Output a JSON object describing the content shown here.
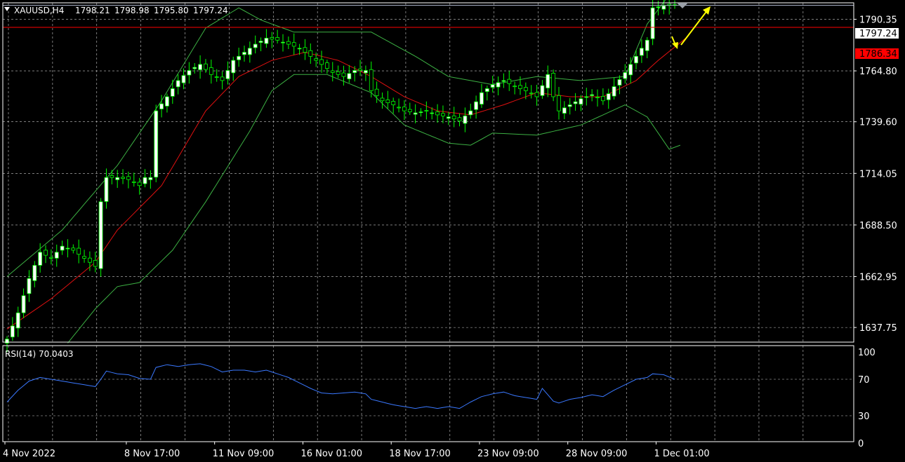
{
  "header": {
    "symbol": "XAUUSD,H4",
    "open": "1798.21",
    "high": "1798.98",
    "low": "1795.80",
    "close": "1797.24"
  },
  "rsi_panel": {
    "label": "RSI(14) 70.0403"
  },
  "colors": {
    "background": "#000000",
    "grid": "#c8c8c8",
    "bull_candle": "#ffffff",
    "bear_candle": "#000000",
    "candle_outline": "#00ff00",
    "bollinger": "#3cb043",
    "moving_average": "#e01010",
    "rsi_line": "#3a78ff",
    "bid_line": "#b0b8d0",
    "level_line": "#ff0000",
    "arrow": "#ffff00"
  },
  "chart_data": [
    {
      "type": "candlestick",
      "ylim": [
        1630.5,
        1798.5
      ],
      "price_ticks": [
        "1790.35",
        "1764.80",
        "1739.60",
        "1714.05",
        "1688.50",
        "1662.95",
        "1637.75"
      ],
      "price_tick_values": [
        1790.35,
        1764.8,
        1739.6,
        1714.05,
        1688.5,
        1662.95,
        1637.75
      ],
      "current_price": {
        "label": "1797.24",
        "value": 1797.24
      },
      "level_line": {
        "label": "1786.34",
        "value": 1786.34
      },
      "x_labels": [
        "4 Nov 2022",
        "8 Nov 17:00",
        "11 Nov 09:00",
        "16 Nov 01:00",
        "18 Nov 17:00",
        "23 Nov 09:00",
        "28 Nov 09:00",
        "1 Dec 01:00"
      ],
      "x_label_bar_index": [
        0,
        22,
        38,
        54,
        70,
        86,
        102,
        118
      ],
      "bar_count": 126,
      "close_anchors": [
        [
          0,
          1632
        ],
        [
          2,
          1645
        ],
        [
          4,
          1662
        ],
        [
          6,
          1675
        ],
        [
          8,
          1672
        ],
        [
          10,
          1678
        ],
        [
          12,
          1676
        ],
        [
          14,
          1672
        ],
        [
          16,
          1668
        ],
        [
          17,
          1700
        ],
        [
          18,
          1712
        ],
        [
          20,
          1712
        ],
        [
          22,
          1711
        ],
        [
          24,
          1708
        ],
        [
          25,
          1712
        ],
        [
          26,
          1712
        ],
        [
          27,
          1745
        ],
        [
          29,
          1752
        ],
        [
          31,
          1760
        ],
        [
          33,
          1765
        ],
        [
          35,
          1768
        ],
        [
          37,
          1763
        ],
        [
          39,
          1760
        ],
        [
          41,
          1770
        ],
        [
          43,
          1774
        ],
        [
          45,
          1778
        ],
        [
          47,
          1781
        ],
        [
          49,
          1780
        ],
        [
          51,
          1778
        ],
        [
          53,
          1776
        ],
        [
          55,
          1772
        ],
        [
          57,
          1768
        ],
        [
          59,
          1764
        ],
        [
          61,
          1762
        ],
        [
          63,
          1765
        ],
        [
          65,
          1765
        ],
        [
          66,
          1755
        ],
        [
          68,
          1750
        ],
        [
          70,
          1748
        ],
        [
          72,
          1745
        ],
        [
          74,
          1744
        ],
        [
          76,
          1745
        ],
        [
          78,
          1743
        ],
        [
          80,
          1742
        ],
        [
          82,
          1740
        ],
        [
          84,
          1745
        ],
        [
          86,
          1754
        ],
        [
          88,
          1758
        ],
        [
          90,
          1760
        ],
        [
          92,
          1757
        ],
        [
          94,
          1755
        ],
        [
          96,
          1752
        ],
        [
          98,
          1763
        ],
        [
          99,
          1752
        ],
        [
          100,
          1745
        ],
        [
          102,
          1748
        ],
        [
          104,
          1751
        ],
        [
          106,
          1753
        ],
        [
          108,
          1750
        ],
        [
          110,
          1757
        ],
        [
          112,
          1764
        ],
        [
          114,
          1772
        ],
        [
          116,
          1780
        ],
        [
          117,
          1796
        ],
        [
          119,
          1797
        ],
        [
          121,
          1797.24
        ]
      ],
      "bollinger_upper_anchors": [
        [
          0,
          1663
        ],
        [
          10,
          1686
        ],
        [
          20,
          1718
        ],
        [
          28,
          1750
        ],
        [
          36,
          1786
        ],
        [
          42,
          1796
        ],
        [
          46,
          1790
        ],
        [
          52,
          1784
        ],
        [
          60,
          1784
        ],
        [
          66,
          1784
        ],
        [
          74,
          1772
        ],
        [
          80,
          1762
        ],
        [
          84,
          1760
        ],
        [
          88,
          1758
        ],
        [
          96,
          1762
        ],
        [
          104,
          1760
        ],
        [
          112,
          1762
        ],
        [
          116,
          1788
        ],
        [
          121,
          1806
        ],
        [
          123,
          1808
        ]
      ],
      "bollinger_lower_anchors": [
        [
          11,
          1630
        ],
        [
          16,
          1647
        ],
        [
          20,
          1658
        ],
        [
          24,
          1660
        ],
        [
          30,
          1676
        ],
        [
          36,
          1700
        ],
        [
          44,
          1735
        ],
        [
          48,
          1755
        ],
        [
          52,
          1763
        ],
        [
          58,
          1763
        ],
        [
          66,
          1754
        ],
        [
          72,
          1738
        ],
        [
          80,
          1729
        ],
        [
          84,
          1728
        ],
        [
          88,
          1734
        ],
        [
          96,
          1733
        ],
        [
          104,
          1738
        ],
        [
          112,
          1748
        ],
        [
          116,
          1742
        ],
        [
          120,
          1726
        ],
        [
          122,
          1728
        ]
      ],
      "moving_average_anchors": [
        [
          0,
          1637
        ],
        [
          8,
          1652
        ],
        [
          16,
          1670
        ],
        [
          20,
          1686
        ],
        [
          28,
          1708
        ],
        [
          36,
          1745
        ],
        [
          42,
          1762
        ],
        [
          48,
          1770
        ],
        [
          54,
          1774
        ],
        [
          60,
          1770
        ],
        [
          66,
          1762
        ],
        [
          72,
          1752
        ],
        [
          78,
          1745
        ],
        [
          84,
          1743
        ],
        [
          90,
          1748
        ],
        [
          96,
          1754
        ],
        [
          102,
          1752
        ],
        [
          108,
          1752
        ],
        [
          114,
          1760
        ],
        [
          118,
          1770
        ],
        [
          123,
          1781
        ]
      ]
    },
    {
      "type": "line",
      "series_label": "RSI(14) 70.0403",
      "ylim": [
        0,
        100
      ],
      "y_ticks": [
        100,
        70,
        30,
        0
      ],
      "rsi_anchors": [
        [
          0,
          45
        ],
        [
          2,
          58
        ],
        [
          4,
          68
        ],
        [
          6,
          72
        ],
        [
          8,
          70
        ],
        [
          10,
          68
        ],
        [
          12,
          66
        ],
        [
          14,
          64
        ],
        [
          16,
          62
        ],
        [
          17,
          70
        ],
        [
          18,
          79
        ],
        [
          20,
          76
        ],
        [
          22,
          75
        ],
        [
          24,
          71
        ],
        [
          26,
          70
        ],
        [
          27,
          83
        ],
        [
          29,
          86
        ],
        [
          31,
          84
        ],
        [
          33,
          86
        ],
        [
          35,
          87
        ],
        [
          37,
          84
        ],
        [
          39,
          78
        ],
        [
          41,
          80
        ],
        [
          43,
          80
        ],
        [
          45,
          78
        ],
        [
          47,
          80
        ],
        [
          49,
          76
        ],
        [
          51,
          72
        ],
        [
          53,
          66
        ],
        [
          55,
          60
        ],
        [
          57,
          55
        ],
        [
          59,
          54
        ],
        [
          61,
          55
        ],
        [
          63,
          56
        ],
        [
          65,
          54
        ],
        [
          66,
          48
        ],
        [
          68,
          45
        ],
        [
          70,
          42
        ],
        [
          72,
          40
        ],
        [
          74,
          38
        ],
        [
          76,
          40
        ],
        [
          78,
          38
        ],
        [
          80,
          40
        ],
        [
          82,
          38
        ],
        [
          84,
          45
        ],
        [
          86,
          51
        ],
        [
          88,
          54
        ],
        [
          90,
          56
        ],
        [
          92,
          52
        ],
        [
          94,
          50
        ],
        [
          96,
          48
        ],
        [
          97,
          60
        ],
        [
          99,
          46
        ],
        [
          100,
          44
        ],
        [
          102,
          48
        ],
        [
          104,
          50
        ],
        [
          106,
          53
        ],
        [
          108,
          51
        ],
        [
          110,
          58
        ],
        [
          112,
          64
        ],
        [
          114,
          70
        ],
        [
          116,
          72
        ],
        [
          117,
          76
        ],
        [
          119,
          75
        ],
        [
          121,
          70
        ]
      ]
    }
  ]
}
